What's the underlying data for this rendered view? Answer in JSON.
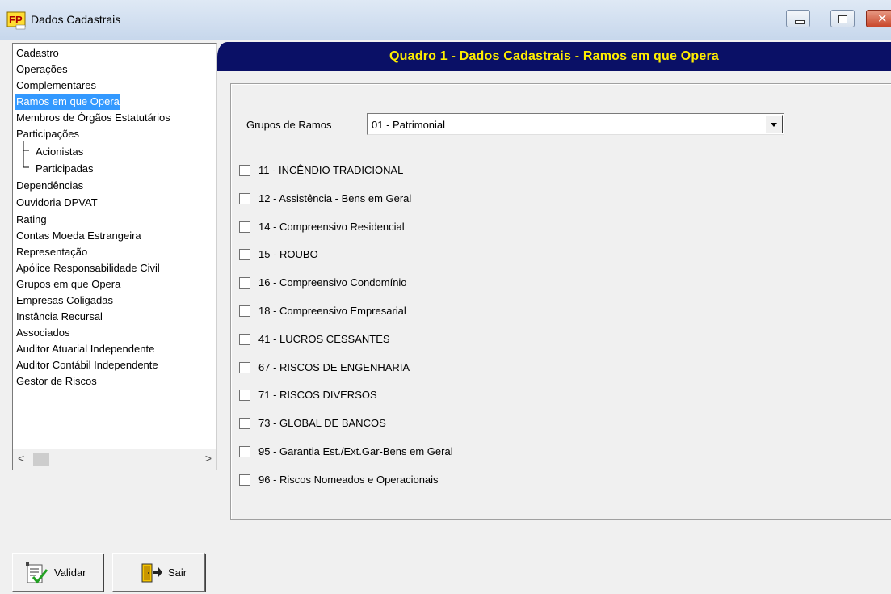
{
  "window": {
    "title": "Dados Cadastrais",
    "icon": "fp-app-icon",
    "close_glyph": "✕"
  },
  "tree": {
    "items": [
      {
        "label": "Cadastro",
        "selected": false
      },
      {
        "label": "Operações",
        "selected": false
      },
      {
        "label": "Complementares",
        "selected": false
      },
      {
        "label": "Ramos em que Opera",
        "selected": true
      },
      {
        "label": "Membros de Órgãos Estatutários",
        "selected": false
      },
      {
        "label": "Participações",
        "selected": false
      },
      {
        "label": "Acionistas",
        "selected": false
      },
      {
        "label": "Participadas",
        "selected": false
      },
      {
        "label": "Dependências",
        "selected": false
      },
      {
        "label": "Ouvidoria DPVAT",
        "selected": false
      },
      {
        "label": "Rating",
        "selected": false
      },
      {
        "label": "Contas Moeda Estrangeira",
        "selected": false
      },
      {
        "label": "Representação",
        "selected": false
      },
      {
        "label": "Apólice Responsabilidade Civil",
        "selected": false
      },
      {
        "label": "Grupos em que Opera",
        "selected": false
      },
      {
        "label": "Empresas Coligadas",
        "selected": false
      },
      {
        "label": "Instância Recursal",
        "selected": false
      },
      {
        "label": "Associados",
        "selected": false
      },
      {
        "label": "Auditor Atuarial Independente",
        "selected": false
      },
      {
        "label": "Auditor Contábil Independente",
        "selected": false
      },
      {
        "label": "Gestor de Riscos",
        "selected": false
      }
    ],
    "scroll_left_glyph": "<",
    "scroll_right_glyph": ">"
  },
  "buttons": {
    "validar": "Validar",
    "sair": "Sair",
    "validar_icon": "checklist-icon",
    "sair_icon": "exit-door-icon"
  },
  "main": {
    "banner_title": "Quadro 1 - Dados Cadastrais - Ramos em que Opera",
    "group_label": "Grupos de Ramos",
    "group_value": "01 - Patrimonial",
    "checkboxes": [
      {
        "label": "11 - INCÊNDIO TRADICIONAL",
        "checked": false
      },
      {
        "label": "12 - Assistência - Bens em Geral",
        "checked": false
      },
      {
        "label": "14 - Compreensivo Residencial",
        "checked": false
      },
      {
        "label": "15 - ROUBO",
        "checked": false
      },
      {
        "label": "16 - Compreensivo Condomínio",
        "checked": false
      },
      {
        "label": "18 - Compreensivo Empresarial",
        "checked": false
      },
      {
        "label": "41 - LUCROS CESSANTES",
        "checked": false
      },
      {
        "label": "67 - RISCOS DE ENGENHARIA",
        "checked": false
      },
      {
        "label": "71 - RISCOS DIVERSOS",
        "checked": false
      },
      {
        "label": "73 - GLOBAL DE BANCOS",
        "checked": false
      },
      {
        "label": "95 - Garantia Est./Ext.Gar-Bens em Geral",
        "checked": false
      },
      {
        "label": "96 - Riscos Nomeados e Operacionais",
        "checked": false
      }
    ]
  },
  "colors": {
    "banner_bg": "#0a1066",
    "banner_text": "#ffee00",
    "selection": "#3399ff"
  }
}
